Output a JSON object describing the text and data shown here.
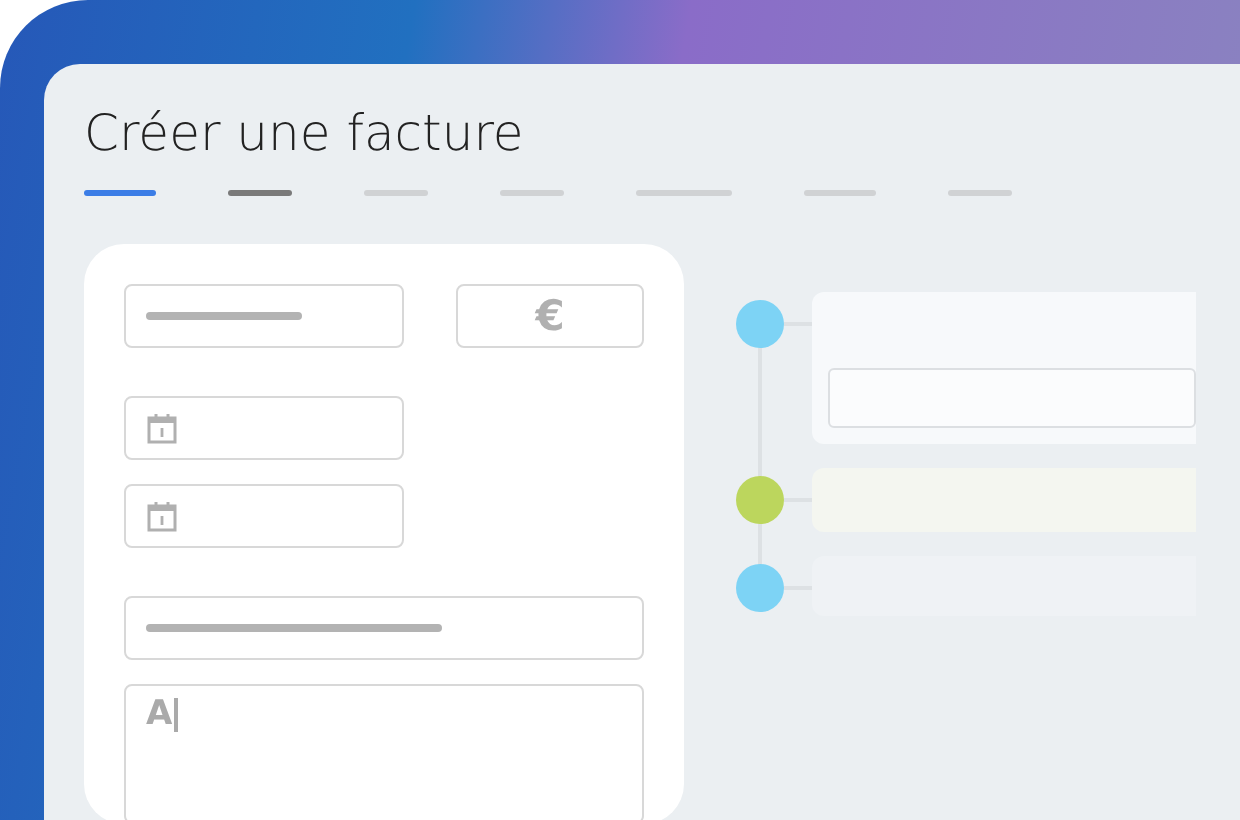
{
  "window": {
    "title": "Créer une facture"
  },
  "steps": [
    {
      "selected": true,
      "done": false
    },
    {
      "selected": false,
      "done": true
    },
    {
      "selected": false,
      "done": false
    },
    {
      "selected": false,
      "done": false
    },
    {
      "selected": false,
      "done": false
    },
    {
      "selected": false,
      "done": false
    },
    {
      "selected": false,
      "done": false
    }
  ],
  "form": [
    {
      "kind": "text"
    },
    {
      "kind": "currency",
      "symbol": "€"
    },
    {
      "kind": "date"
    },
    {
      "kind": "date"
    },
    {
      "kind": "wide"
    },
    {
      "kind": "textarea",
      "value": "A"
    }
  ],
  "timeline": [
    {
      "color": "#7dd3f5",
      "kind": "field"
    },
    {
      "color": "#bcd65d",
      "kind": "tinted"
    },
    {
      "color": "#7dd3f5",
      "kind": "plain"
    }
  ]
}
